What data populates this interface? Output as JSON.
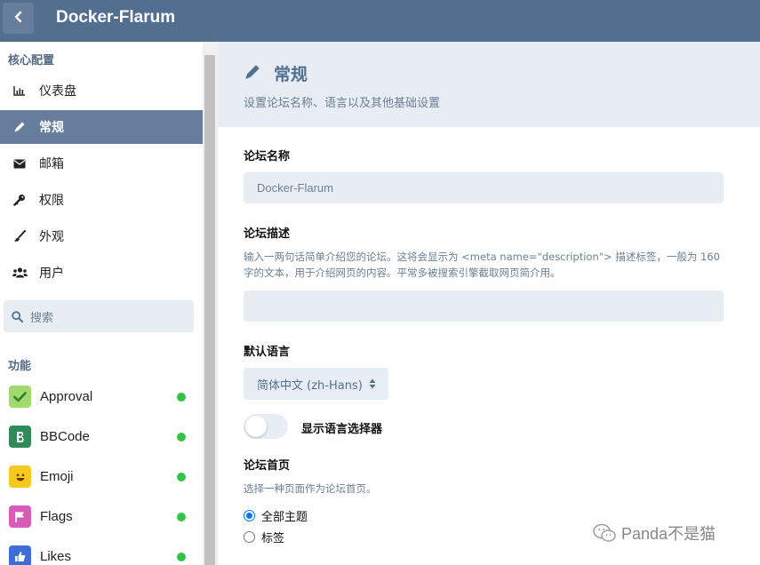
{
  "header": {
    "title": "Docker-Flarum"
  },
  "sidebar": {
    "core_title": "核心配置",
    "items": [
      {
        "label": "仪表盘",
        "icon": "bar-chart-icon"
      },
      {
        "label": "常规",
        "icon": "pencil-icon",
        "active": true
      },
      {
        "label": "邮箱",
        "icon": "envelope-icon"
      },
      {
        "label": "权限",
        "icon": "key-icon"
      },
      {
        "label": "外观",
        "icon": "paintbrush-icon"
      },
      {
        "label": "用户",
        "icon": "users-icon"
      }
    ],
    "search_placeholder": "搜索",
    "features_title": "功能",
    "extensions": [
      {
        "label": "Approval",
        "color": "#a2d96f",
        "enabled": true
      },
      {
        "label": "BBCode",
        "color": "#2e8b57",
        "enabled": true
      },
      {
        "label": "Emoji",
        "color": "#f7c81e",
        "enabled": true
      },
      {
        "label": "Flags",
        "color": "#d65cb8",
        "enabled": true
      },
      {
        "label": "Likes",
        "color": "#3b6fd6",
        "enabled": true
      }
    ],
    "enabled_color": "#33c447"
  },
  "main": {
    "page_title": "常规",
    "page_desc": "设置论坛名称、语言以及其他基础设置",
    "forum_name_label": "论坛名称",
    "forum_name_value": "Docker-Flarum",
    "forum_desc_label": "论坛描述",
    "forum_desc_help": "输入一两句话简单介绍您的论坛。这将会显示为 <meta name=\"description\"> 描述标签，一般为 160 字的文本，用于介绍网页的内容。平常多被搜索引擎截取网页简介用。",
    "forum_desc_value": "",
    "default_lang_label": "默认语言",
    "default_lang_value": "简体中文 (zh-Hans)",
    "show_lang_selector_label": "显示语言选择器",
    "show_lang_selector_on": false,
    "homepage_label": "论坛首页",
    "homepage_help": "选择一种页面作为论坛首页。",
    "homepage_options": [
      {
        "label": "全部主题",
        "checked": true
      },
      {
        "label": "标签",
        "checked": false
      }
    ]
  },
  "watermark": {
    "text": "Panda不是猫"
  },
  "colors": {
    "header": "#536f90",
    "active_nav": "#667e9b",
    "field_bg": "#e7edf3",
    "muted_text": "#6c7f94"
  }
}
